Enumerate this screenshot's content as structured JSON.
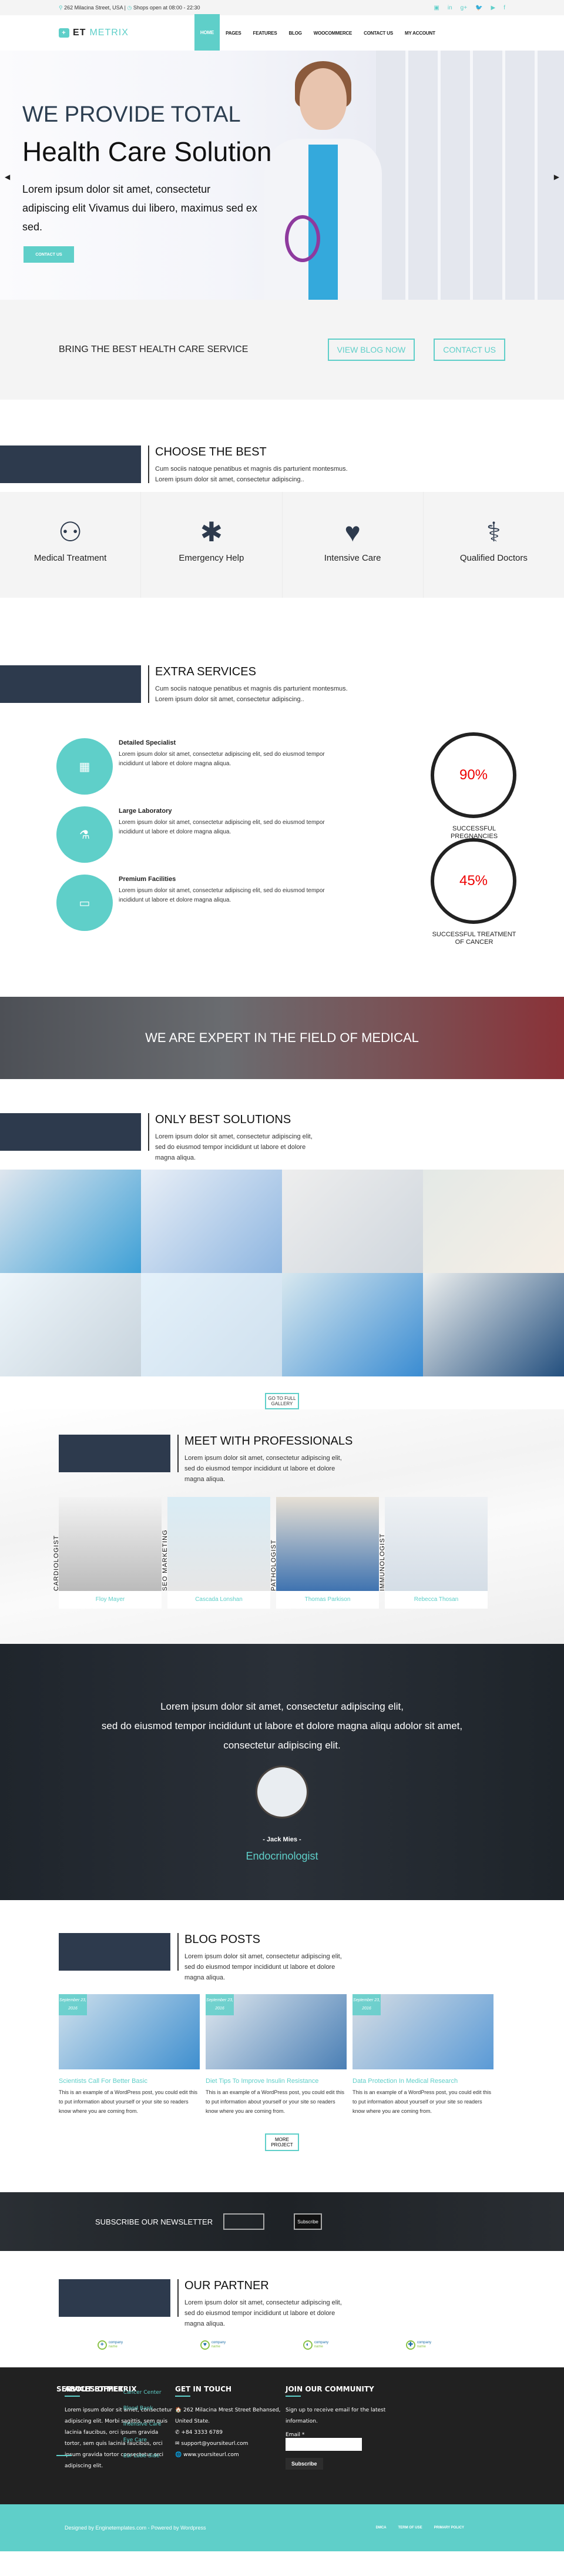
{
  "topbar": {
    "address": "262 Milacina Street, USA",
    "hours": "Shops open at 08:00 - 22:30",
    "social": [
      "instagram-icon",
      "linkedin-icon",
      "google-plus-icon",
      "twitter-icon",
      "youtube-icon",
      "facebook-icon"
    ],
    "social_glyphs": [
      "▣",
      "in",
      "g+",
      "🐦",
      "▶",
      "f"
    ]
  },
  "header": {
    "logo_part1": "ET",
    "logo_part2": "METRIX",
    "nav": [
      "HOME",
      "PAGES",
      "FEATURES",
      "BLOG",
      "WOOCOMMERCE",
      "CONTACT US",
      "MY ACCOUNT"
    ],
    "active": "HOME"
  },
  "hero": {
    "line1": "WE PROVIDE TOTAL",
    "line2": "Health Care Solution",
    "text": "Lorem ipsum dolor sit amet, consectetur adipiscing elit Vivamus dui libero, maximus sed ex sed.",
    "cta": "CONTACT US",
    "prev": "◀",
    "next": "▶"
  },
  "bring": {
    "title": "BRING THE BEST HEALTH CARE SERVICE",
    "btn1": "VIEW BLOG NOW",
    "btn2": "CONTACT US"
  },
  "choose": {
    "title": "CHOOSE THE BEST",
    "line1": "Cum sociis natoque penatibus et magnis dis parturient montesmus.",
    "line2": "Lorem ipsum dolor sit amet, consectetur adipiscing.."
  },
  "features": [
    {
      "label": "Medical Treatment",
      "icon": "👨‍⚕️"
    },
    {
      "label": "Emergency Help",
      "icon": "✱"
    },
    {
      "label": "Intensive Care",
      "icon": "♥"
    },
    {
      "label": "Qualified Doctors",
      "icon": "⚕"
    }
  ],
  "extra": {
    "title": "EXTRA SERVICES",
    "line1": "Cum sociis natoque penatibus et magnis dis parturient montesmus.",
    "line2": "Lorem ipsum dolor sit amet, consectetur adipiscing..",
    "services": [
      {
        "title": "Detailed Specialist",
        "text": "Lorem ipsum dolor sit amet, consectetur adipiscing elit, sed do eiusmod tempor incididunt ut labore et dolore magna aliqua.",
        "icon": "🏥"
      },
      {
        "title": "Large Laboratory",
        "text": "Lorem ipsum dolor sit amet, consectetur adipiscing elit, sed do eiusmod tempor incididunt ut labore et dolore magna aliqua.",
        "icon": "⚗"
      },
      {
        "title": "Premium Facilities",
        "text": "Lorem ipsum dolor sit amet, consectetur adipiscing elit, sed do eiusmod tempor incididunt ut labore et dolore magna aliqua.",
        "icon": "💻"
      }
    ],
    "stats": [
      {
        "value": "90%",
        "label": "SUCCESSFUL PREGNANCIES"
      },
      {
        "value": "45%",
        "label": "SUCCESSFUL TREATMENT OF CANCER"
      }
    ]
  },
  "banner": {
    "title": "WE ARE EXPERT IN THE FIELD OF MEDICAL"
  },
  "solutions": {
    "title": "ONLY BEST SOLUTIONS",
    "text": "Lorem ipsum dolor sit amet, consectetur adipiscing elit, sed do eiusmod tempor incididunt ut labore et dolore magna aliqua.",
    "gallery_button": "GO TO FULL GALLERY"
  },
  "team": {
    "title": "MEET WITH PROFESSIONALS",
    "text": "Lorem ipsum dolor sit amet, consectetur adipiscing elit, sed do eiusmod tempor incididunt ut labore et dolore magna aliqua.",
    "members": [
      {
        "name": "Floy Mayer",
        "role": "CARDIOLOGIST"
      },
      {
        "name": "Cascada Lonshan",
        "role": "SEO MARKETING"
      },
      {
        "name": "Thomas Parkison",
        "role": "PATHOLOGIST"
      },
      {
        "name": "Rebecca Thosan",
        "role": "IMMUNOLOGIST"
      }
    ]
  },
  "testimonial": {
    "line1": "Lorem ipsum dolor sit amet, consectetur adipiscing elit,",
    "line2": "sed do eiusmod tempor incididunt ut labore et dolore magna aliqu adolor sit amet,",
    "line3": "consectetur adipiscing elit.",
    "name": "- Jack Mies -",
    "role": "Endocrinologist"
  },
  "blog": {
    "title": "BLOG POSTS",
    "text": "Lorem ipsum dolor sit amet, consectetur adipiscing elit, sed do eiusmod tempor incididunt ut labore et dolore magna aliqua.",
    "posts": [
      {
        "date": "September 23, 2016",
        "title": "Scientists Call For Better Basic",
        "excerpt": "This is an example of a WordPress post, you could edit this to put information about yourself or your site so readers know where you are coming from."
      },
      {
        "date": "September 23, 2016",
        "title": "Diet Tips To Improve Insulin Resistance",
        "excerpt": "This is an example of a WordPress post, you could edit this to put information about yourself or your site so readers know where you are coming from."
      },
      {
        "date": "September 23, 2016",
        "title": "Data Protection In Medical Research",
        "excerpt": "This is an example of a WordPress post, you could edit this to put information about yourself or your site so readers know where you are coming from."
      }
    ],
    "more": "MORE PROJECT"
  },
  "newsletter": {
    "title": "SUBSCRIBE OUR NEWSLETTER",
    "input_value": "",
    "button": "Subscribe"
  },
  "partner": {
    "title": "OUR PARTNER",
    "text": "Lorem ipsum dolor sit amet, consectetur adipiscing elit, sed do eiusmod tempor incididunt ut labore et dolore magna aliqua.",
    "logos": [
      {
        "l1": "company",
        "l2": "name",
        "mark": "+"
      },
      {
        "l1": "company",
        "l2": "name",
        "mark": "♥"
      },
      {
        "l1": "company",
        "l2": "name",
        "mark": "◐"
      },
      {
        "l1": "company",
        "l2": "name",
        "mark": "✚"
      }
    ]
  },
  "footer": {
    "about": {
      "title": "ABOUT ET METRIX",
      "text": "Lorem ipsum dolor sit amet, consectetur adipiscing elit. Morbi sagittis, sem quis lacinia faucibus, orci ipsum gravida tortor, sem quis lacinia faucibus, orci ipsum gravida tortor consectetur orci adipiscing elit."
    },
    "contact": {
      "title": "GET IN TOUCH",
      "address": "🏠 262 Milacina Mrest Street Behansed, United State.",
      "phone": "✆ +84 3333 6789",
      "email": "✉ support@yoursiteurl.com",
      "web": "🌐 www.yoursiteurl.com"
    },
    "services": {
      "title": "SERVICES OFFER",
      "items": [
        "Cancer Center",
        "Blood Bank",
        "Intensive Care",
        "Eye Care",
        "Ear Lobe Side"
      ]
    },
    "join": {
      "title": "JOIN OUR COMMUNITY",
      "text": "Sign up to receive email for the latest information.",
      "email_label": "Email *",
      "button": "Subscribe"
    },
    "credit": "Designed by Enginetemplates.com - Powered by Wordpress",
    "links": [
      "DMCA",
      "TERM OF USE",
      "PRIMARY POLICY"
    ]
  },
  "colors": {
    "accent": "#5fcfc9",
    "dark": "#2d3a4d",
    "stat_value": "#ee0000"
  }
}
